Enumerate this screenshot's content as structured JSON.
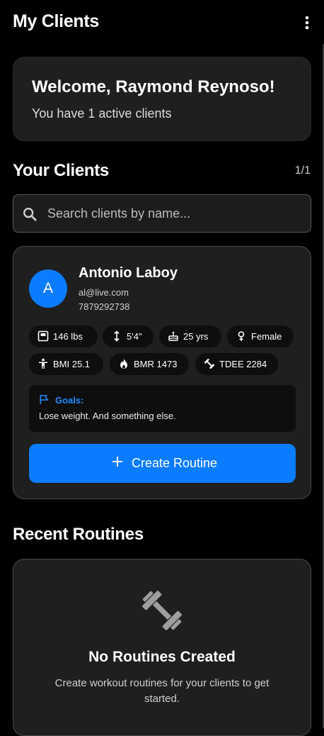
{
  "appbar": {
    "title": "My Clients",
    "menu_icon": "more-vert-icon"
  },
  "welcome": {
    "heading": "Welcome, Raymond Reynoso!",
    "subtitle": "You have 1 active clients"
  },
  "clients_section": {
    "title": "Your Clients",
    "count": "1/1"
  },
  "search": {
    "placeholder": "Search clients by name...",
    "icon": "search-icon"
  },
  "client": {
    "initial": "A",
    "name": "Antonio Laboy",
    "email": "al@live.com",
    "phone": "7879292738",
    "stats": [
      {
        "icon": "scale-icon",
        "label": "146 lbs"
      },
      {
        "icon": "height-icon",
        "label": "5'4\""
      },
      {
        "icon": "cake-icon",
        "label": "25 yrs"
      },
      {
        "icon": "female-icon",
        "label": "Female"
      },
      {
        "icon": "person-icon",
        "label": "BMI 25.1"
      },
      {
        "icon": "flame-icon",
        "label": "BMR 1473"
      },
      {
        "icon": "dumbbell-icon",
        "label": "TDEE 2284"
      }
    ],
    "goals_label": "Goals:",
    "goals_text": "Lose weight. And something else.",
    "create_button": "Create Routine"
  },
  "routines_section": {
    "title": "Recent Routines",
    "empty_title": "No Routines Created",
    "empty_desc": "Create workout routines for your clients to get started."
  },
  "colors": {
    "accent": "#0a7cff",
    "card": "#1f1f1f",
    "background": "#000000"
  }
}
